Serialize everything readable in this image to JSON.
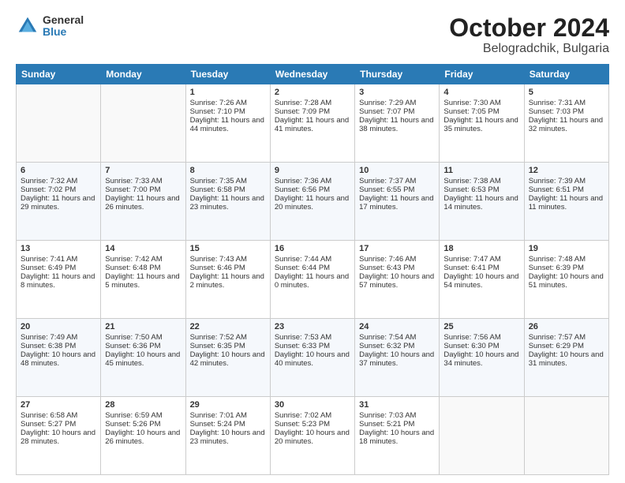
{
  "header": {
    "logo_general": "General",
    "logo_blue": "Blue",
    "month": "October 2024",
    "location": "Belogradchik, Bulgaria"
  },
  "days_of_week": [
    "Sunday",
    "Monday",
    "Tuesday",
    "Wednesday",
    "Thursday",
    "Friday",
    "Saturday"
  ],
  "weeks": [
    [
      {
        "day": "",
        "info": ""
      },
      {
        "day": "",
        "info": ""
      },
      {
        "day": "1",
        "info": "Sunrise: 7:26 AM\nSunset: 7:10 PM\nDaylight: 11 hours and 44 minutes."
      },
      {
        "day": "2",
        "info": "Sunrise: 7:28 AM\nSunset: 7:09 PM\nDaylight: 11 hours and 41 minutes."
      },
      {
        "day": "3",
        "info": "Sunrise: 7:29 AM\nSunset: 7:07 PM\nDaylight: 11 hours and 38 minutes."
      },
      {
        "day": "4",
        "info": "Sunrise: 7:30 AM\nSunset: 7:05 PM\nDaylight: 11 hours and 35 minutes."
      },
      {
        "day": "5",
        "info": "Sunrise: 7:31 AM\nSunset: 7:03 PM\nDaylight: 11 hours and 32 minutes."
      }
    ],
    [
      {
        "day": "6",
        "info": "Sunrise: 7:32 AM\nSunset: 7:02 PM\nDaylight: 11 hours and 29 minutes."
      },
      {
        "day": "7",
        "info": "Sunrise: 7:33 AM\nSunset: 7:00 PM\nDaylight: 11 hours and 26 minutes."
      },
      {
        "day": "8",
        "info": "Sunrise: 7:35 AM\nSunset: 6:58 PM\nDaylight: 11 hours and 23 minutes."
      },
      {
        "day": "9",
        "info": "Sunrise: 7:36 AM\nSunset: 6:56 PM\nDaylight: 11 hours and 20 minutes."
      },
      {
        "day": "10",
        "info": "Sunrise: 7:37 AM\nSunset: 6:55 PM\nDaylight: 11 hours and 17 minutes."
      },
      {
        "day": "11",
        "info": "Sunrise: 7:38 AM\nSunset: 6:53 PM\nDaylight: 11 hours and 14 minutes."
      },
      {
        "day": "12",
        "info": "Sunrise: 7:39 AM\nSunset: 6:51 PM\nDaylight: 11 hours and 11 minutes."
      }
    ],
    [
      {
        "day": "13",
        "info": "Sunrise: 7:41 AM\nSunset: 6:49 PM\nDaylight: 11 hours and 8 minutes."
      },
      {
        "day": "14",
        "info": "Sunrise: 7:42 AM\nSunset: 6:48 PM\nDaylight: 11 hours and 5 minutes."
      },
      {
        "day": "15",
        "info": "Sunrise: 7:43 AM\nSunset: 6:46 PM\nDaylight: 11 hours and 2 minutes."
      },
      {
        "day": "16",
        "info": "Sunrise: 7:44 AM\nSunset: 6:44 PM\nDaylight: 11 hours and 0 minutes."
      },
      {
        "day": "17",
        "info": "Sunrise: 7:46 AM\nSunset: 6:43 PM\nDaylight: 10 hours and 57 minutes."
      },
      {
        "day": "18",
        "info": "Sunrise: 7:47 AM\nSunset: 6:41 PM\nDaylight: 10 hours and 54 minutes."
      },
      {
        "day": "19",
        "info": "Sunrise: 7:48 AM\nSunset: 6:39 PM\nDaylight: 10 hours and 51 minutes."
      }
    ],
    [
      {
        "day": "20",
        "info": "Sunrise: 7:49 AM\nSunset: 6:38 PM\nDaylight: 10 hours and 48 minutes."
      },
      {
        "day": "21",
        "info": "Sunrise: 7:50 AM\nSunset: 6:36 PM\nDaylight: 10 hours and 45 minutes."
      },
      {
        "day": "22",
        "info": "Sunrise: 7:52 AM\nSunset: 6:35 PM\nDaylight: 10 hours and 42 minutes."
      },
      {
        "day": "23",
        "info": "Sunrise: 7:53 AM\nSunset: 6:33 PM\nDaylight: 10 hours and 40 minutes."
      },
      {
        "day": "24",
        "info": "Sunrise: 7:54 AM\nSunset: 6:32 PM\nDaylight: 10 hours and 37 minutes."
      },
      {
        "day": "25",
        "info": "Sunrise: 7:56 AM\nSunset: 6:30 PM\nDaylight: 10 hours and 34 minutes."
      },
      {
        "day": "26",
        "info": "Sunrise: 7:57 AM\nSunset: 6:29 PM\nDaylight: 10 hours and 31 minutes."
      }
    ],
    [
      {
        "day": "27",
        "info": "Sunrise: 6:58 AM\nSunset: 5:27 PM\nDaylight: 10 hours and 28 minutes."
      },
      {
        "day": "28",
        "info": "Sunrise: 6:59 AM\nSunset: 5:26 PM\nDaylight: 10 hours and 26 minutes."
      },
      {
        "day": "29",
        "info": "Sunrise: 7:01 AM\nSunset: 5:24 PM\nDaylight: 10 hours and 23 minutes."
      },
      {
        "day": "30",
        "info": "Sunrise: 7:02 AM\nSunset: 5:23 PM\nDaylight: 10 hours and 20 minutes."
      },
      {
        "day": "31",
        "info": "Sunrise: 7:03 AM\nSunset: 5:21 PM\nDaylight: 10 hours and 18 minutes."
      },
      {
        "day": "",
        "info": ""
      },
      {
        "day": "",
        "info": ""
      }
    ]
  ]
}
